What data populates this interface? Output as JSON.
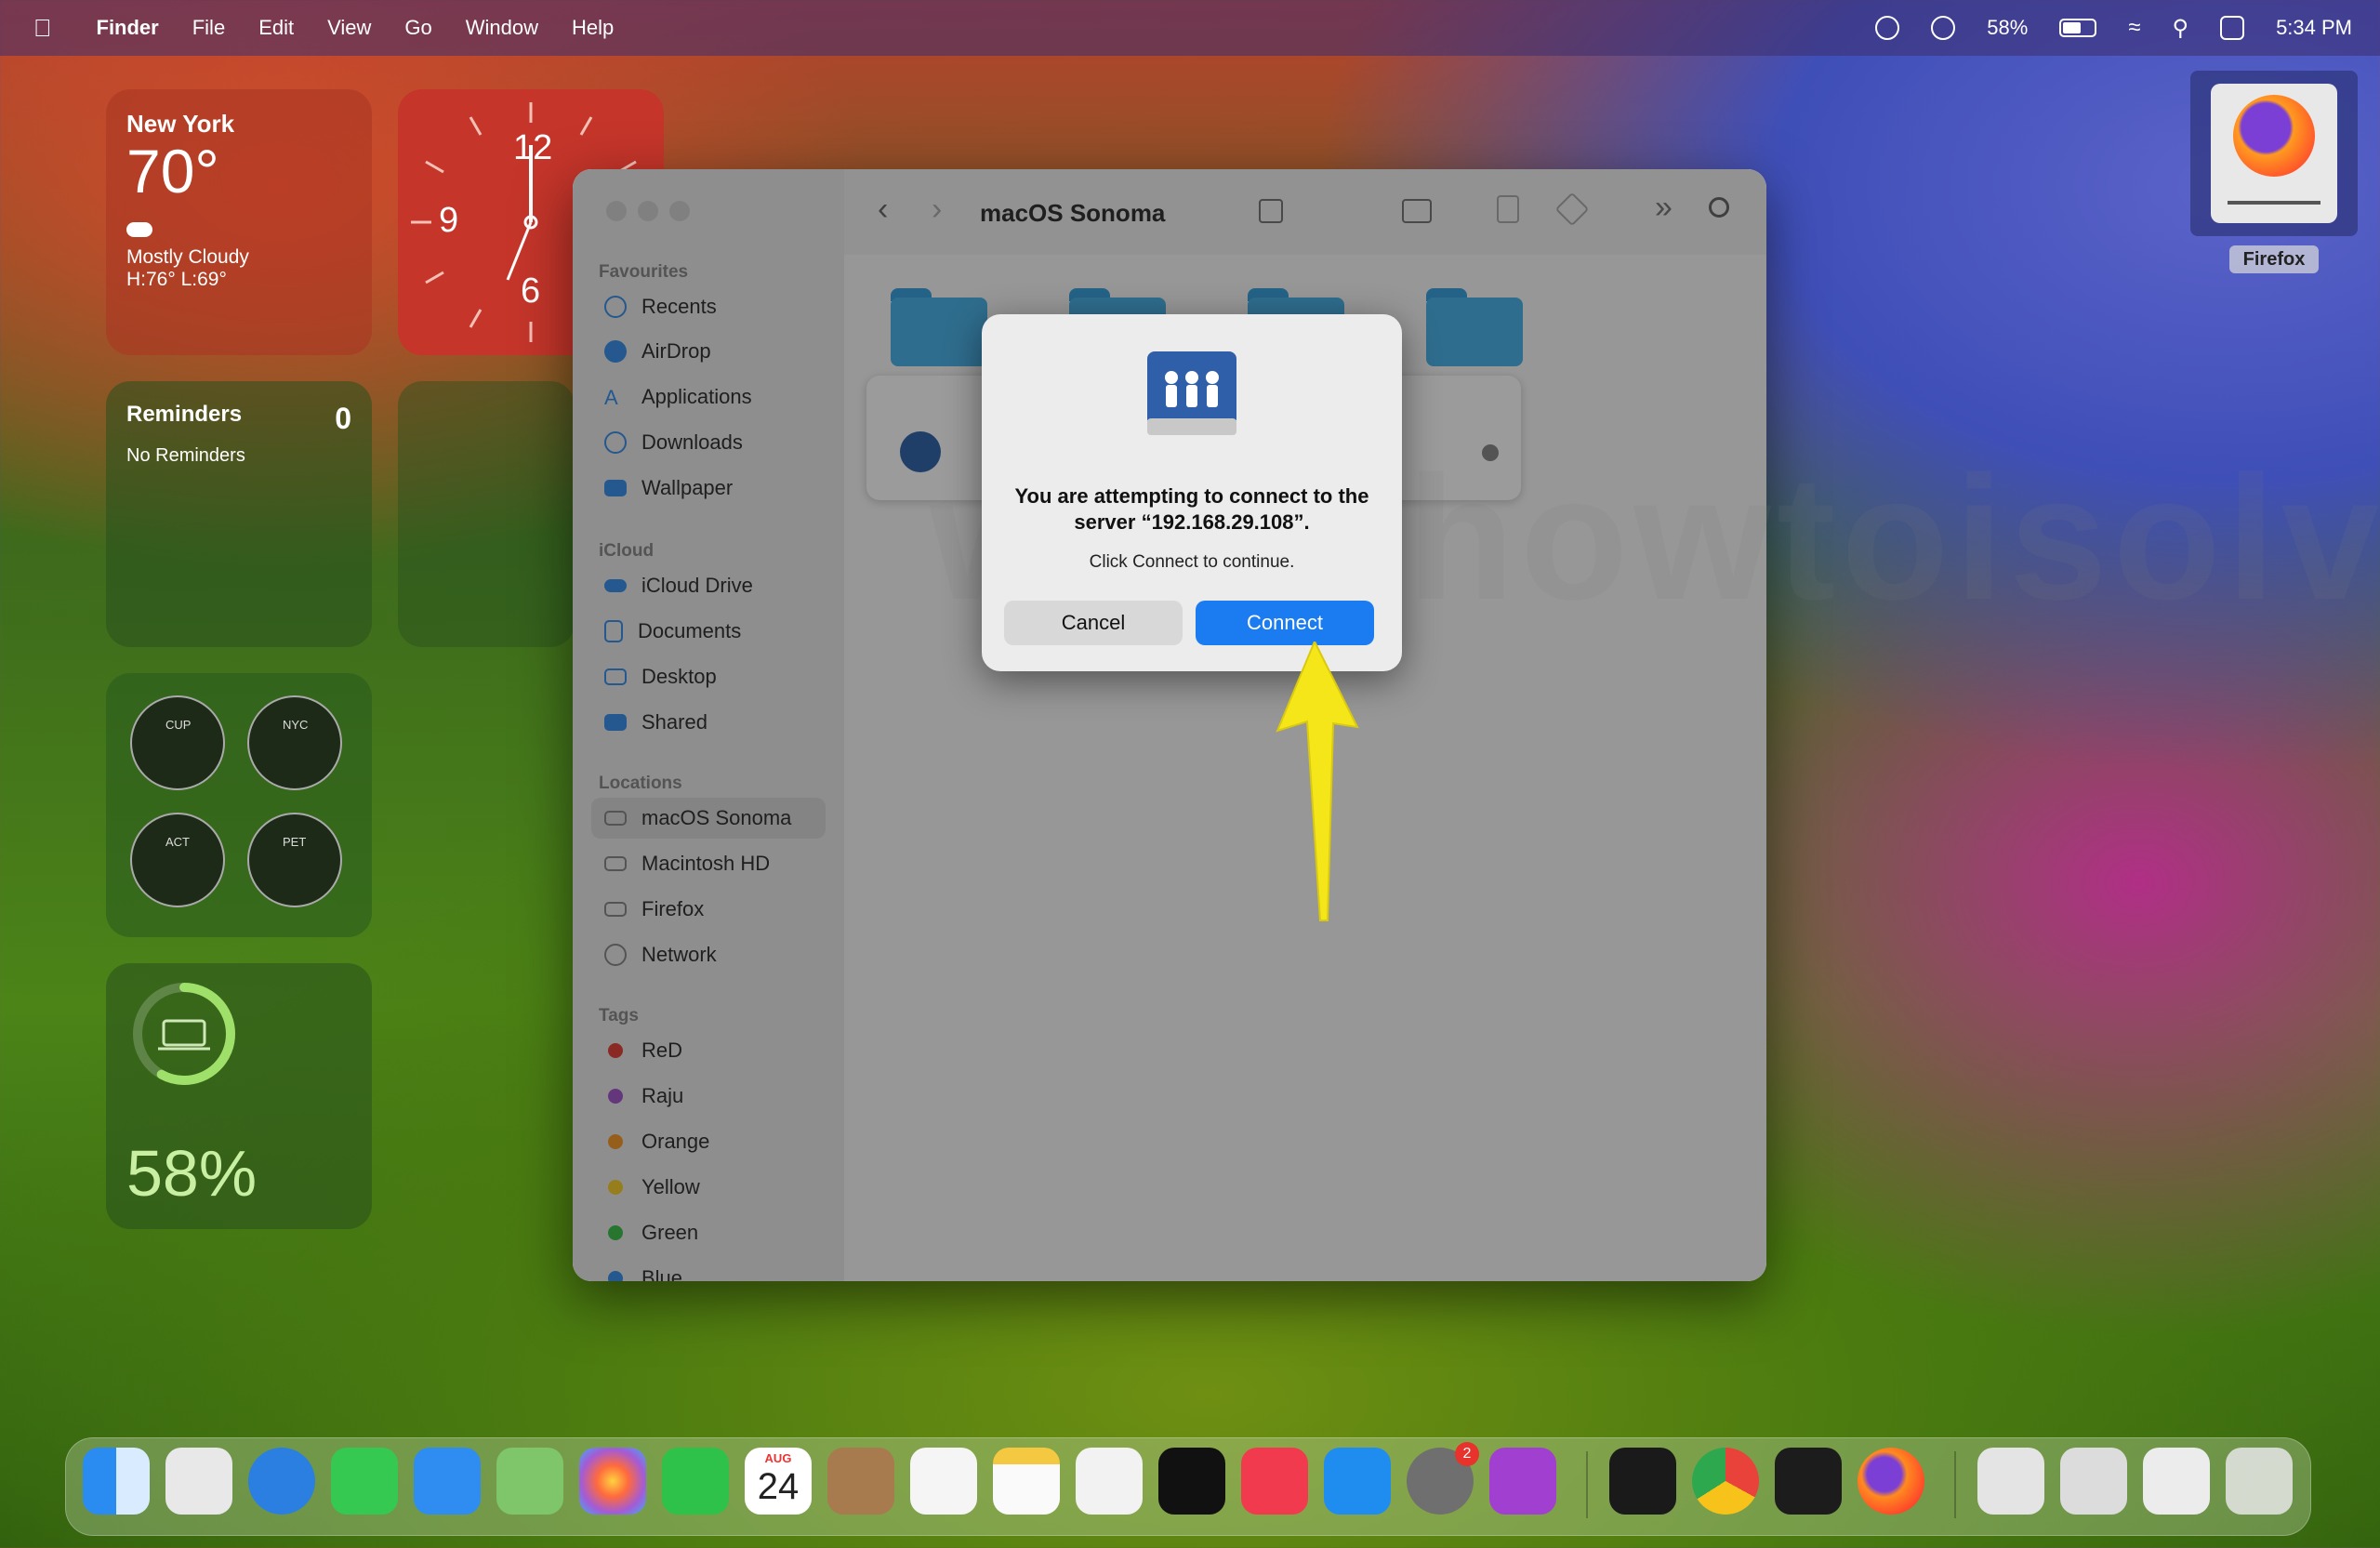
{
  "menubar": {
    "app_name": "Finder",
    "menus": [
      "File",
      "Edit",
      "View",
      "Go",
      "Window",
      "Help"
    ],
    "battery_percent": "58%",
    "battery_level": 0.58,
    "time": "5:34 PM"
  },
  "widgets": {
    "weather": {
      "city": "New York",
      "temp": "70°",
      "condition": "Mostly Cloudy",
      "hilo": "H:76° L:69°"
    },
    "clock": {
      "n12": "12",
      "n9": "9",
      "n6": "6"
    },
    "reminders": {
      "title": "Reminders",
      "count": "0",
      "empty": "No Reminders"
    },
    "world_clocks": [
      "CUP",
      "NYC",
      "ACT",
      "PET"
    ],
    "battery": {
      "percent": "58%",
      "level": 0.58
    }
  },
  "finder": {
    "title": "macOS Sonoma",
    "sidebar": {
      "favourites_head": "Favourites",
      "favourites": [
        "Recents",
        "AirDrop",
        "Applications",
        "Downloads",
        "Wallpaper"
      ],
      "icloud_head": "iCloud",
      "icloud": [
        "iCloud Drive",
        "Documents",
        "Desktop",
        "Shared"
      ],
      "locations_head": "Locations",
      "locations": [
        "macOS Sonoma",
        "Macintosh HD",
        "Firefox",
        "Network"
      ],
      "tags_head": "Tags",
      "tags": [
        {
          "label": "ReD",
          "color": "#e0443a"
        },
        {
          "label": "Raju",
          "color": "#a259c9"
        },
        {
          "label": "Orange",
          "color": "#f19a2c"
        },
        {
          "label": "Yellow",
          "color": "#f2cc2f"
        },
        {
          "label": "Green",
          "color": "#3fbd4c"
        },
        {
          "label": "Blue",
          "color": "#3a8ee6"
        }
      ]
    }
  },
  "dialog": {
    "message": "You are attempting to connect to the server “192.168.29.108”.",
    "sub": "Click Connect to continue.",
    "cancel": "Cancel",
    "connect": "Connect"
  },
  "watermark": "www.howtoisolve.com",
  "desktop_icon": {
    "label": "Firefox"
  },
  "dock": {
    "calendar_month": "AUG",
    "calendar_day": "24",
    "settings_badge": "2",
    "apps": [
      "finder",
      "launchpad",
      "safari",
      "messages",
      "mail",
      "maps",
      "photos",
      "facetime",
      "calendar",
      "contacts",
      "reminders",
      "notes",
      "freeform",
      "tv",
      "music",
      "app-store",
      "system-settings",
      "feedback",
      "activity-monitor",
      "chrome",
      "terminal",
      "firefox",
      "preview-stack",
      "documents-stack",
      "downloads-stack",
      "trash"
    ]
  },
  "colors": {
    "accent": "#1a7cf0",
    "arrow": "#f5e61a",
    "folder": "#4cb1e6"
  }
}
